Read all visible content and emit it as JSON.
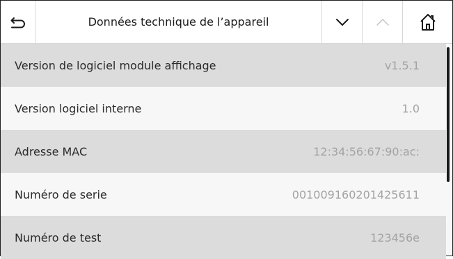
{
  "header": {
    "title": "Données technique de l’appareil",
    "back_icon": "back-arrow-icon",
    "down_icon": "chevron-down-icon",
    "up_icon": "chevron-up-icon",
    "home_icon": "home-icon"
  },
  "rows": [
    {
      "label": "Version de logiciel module affichage",
      "value": "v1.5.1"
    },
    {
      "label": "Version logiciel interne",
      "value": "1.0"
    },
    {
      "label": "Adresse MAC",
      "value": "12:34:56:67:90:ac:"
    },
    {
      "label": "Numéro de serie",
      "value": "001009160201425611"
    },
    {
      "label": "Numéro de test",
      "value": "123456e"
    }
  ],
  "colors": {
    "row_gray": "#dcdcdc",
    "row_white": "#f7f7f7",
    "value_text": "#a3a3a3",
    "disabled_icon": "#c4c4c4"
  }
}
